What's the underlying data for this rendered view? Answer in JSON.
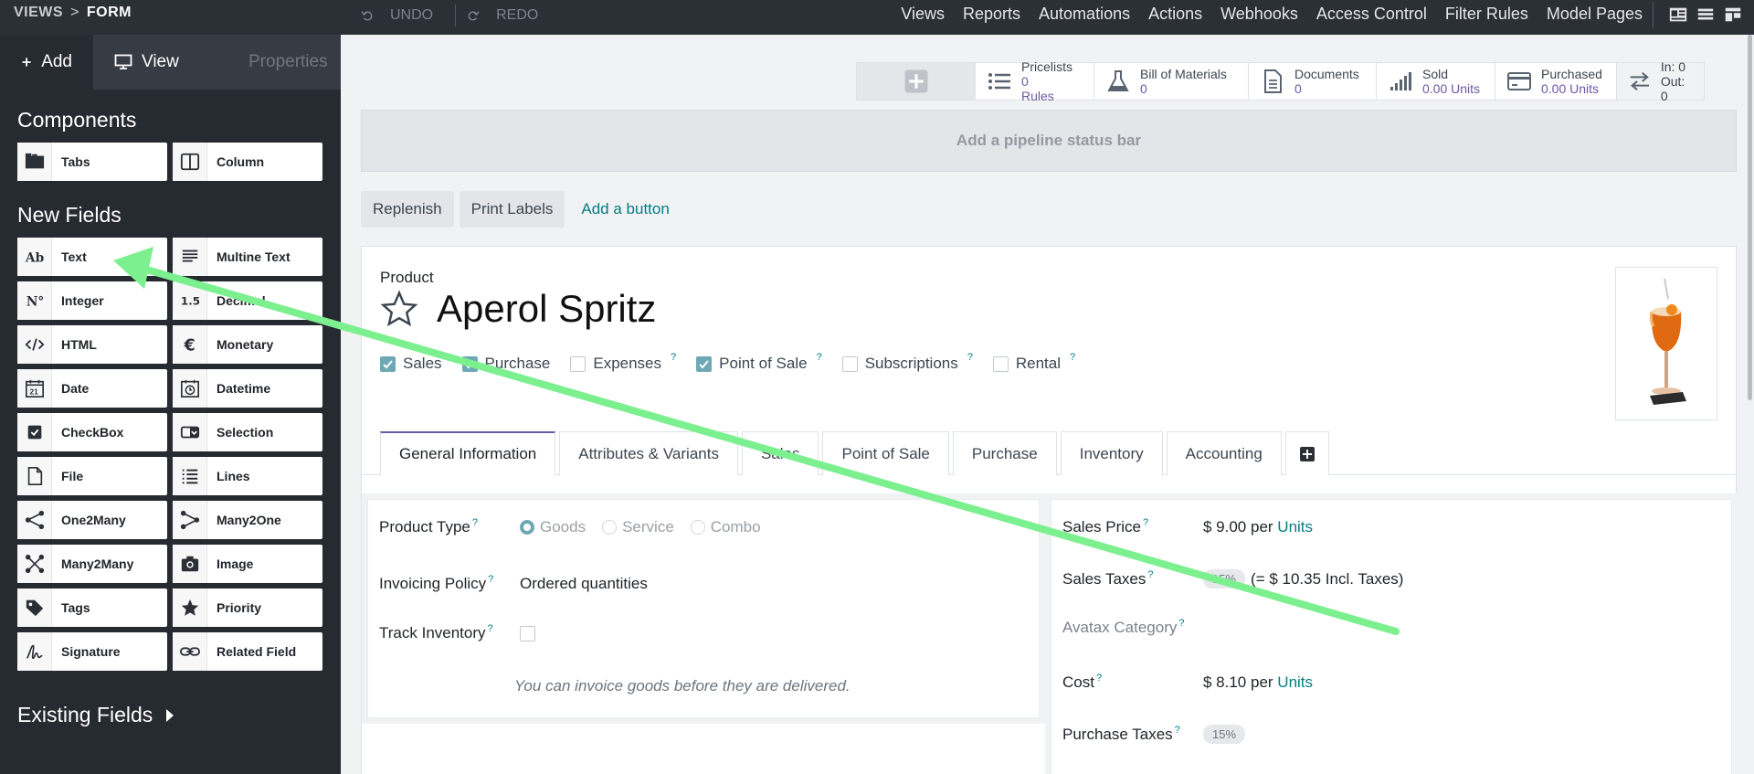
{
  "topbar": {
    "crumb_root": "VIEWS",
    "crumb_sep": ">",
    "crumb_current": "FORM",
    "undo": "UNDO",
    "redo": "REDO",
    "menu": [
      "Views",
      "Reports",
      "Automations",
      "Actions",
      "Webhooks",
      "Access Control",
      "Filter Rules",
      "Model Pages"
    ]
  },
  "sidebar": {
    "tabs": {
      "add": "Add",
      "view": "View",
      "properties": "Properties"
    },
    "components_title": "Components",
    "components": [
      {
        "label": "Tabs",
        "icon": "tabs-icon"
      },
      {
        "label": "Column",
        "icon": "column-icon"
      }
    ],
    "new_fields_title": "New Fields",
    "fields": [
      {
        "label": "Text",
        "icon": "text-icon"
      },
      {
        "label": "Multine Text",
        "icon": "multiline-text-icon"
      },
      {
        "label": "Integer",
        "icon": "integer-icon"
      },
      {
        "label": "Decimal",
        "icon": "decimal-icon"
      },
      {
        "label": "HTML",
        "icon": "html-icon"
      },
      {
        "label": "Monetary",
        "icon": "monetary-icon"
      },
      {
        "label": "Date",
        "icon": "date-icon"
      },
      {
        "label": "Datetime",
        "icon": "datetime-icon"
      },
      {
        "label": "CheckBox",
        "icon": "checkbox-icon"
      },
      {
        "label": "Selection",
        "icon": "selection-icon"
      },
      {
        "label": "File",
        "icon": "file-icon"
      },
      {
        "label": "Lines",
        "icon": "lines-icon"
      },
      {
        "label": "One2Many",
        "icon": "one2many-icon"
      },
      {
        "label": "Many2One",
        "icon": "many2one-icon"
      },
      {
        "label": "Many2Many",
        "icon": "many2many-icon"
      },
      {
        "label": "Image",
        "icon": "image-icon"
      },
      {
        "label": "Tags",
        "icon": "tags-icon"
      },
      {
        "label": "Priority",
        "icon": "priority-icon"
      },
      {
        "label": "Signature",
        "icon": "signature-icon"
      },
      {
        "label": "Related Field",
        "icon": "related-field-icon"
      }
    ],
    "existing_fields": "Existing Fields"
  },
  "smart_buttons": {
    "pricelists": {
      "label": "Pricelists",
      "value": "0",
      "sub": "Rules"
    },
    "bom": {
      "label": "Bill of Materials",
      "value": "0"
    },
    "documents": {
      "label": "Documents",
      "value": "0"
    },
    "sold": {
      "label": "Sold",
      "value": "0.00 Units"
    },
    "purchased": {
      "label": "Purchased",
      "value": "0.00 Units"
    },
    "inout": {
      "in": "In: 0",
      "out": "Out: 0"
    }
  },
  "pipeline": "Add a pipeline status bar",
  "buttons": {
    "replenish": "Replenish",
    "print_labels": "Print Labels",
    "add_button": "Add a button"
  },
  "product": {
    "label": "Product",
    "name": "Aperol Spritz",
    "checks": [
      {
        "label": "Sales",
        "checked": true,
        "help": false
      },
      {
        "label": "Purchase",
        "checked": true,
        "help": false
      },
      {
        "label": "Expenses",
        "checked": false,
        "help": true
      },
      {
        "label": "Point of Sale",
        "checked": true,
        "help": true
      },
      {
        "label": "Subscriptions",
        "checked": false,
        "help": true
      },
      {
        "label": "Rental",
        "checked": false,
        "help": true
      }
    ]
  },
  "tabs": [
    "General Information",
    "Attributes & Variants",
    "Sales",
    "Point of Sale",
    "Purchase",
    "Inventory",
    "Accounting"
  ],
  "help_mark": "?",
  "general": {
    "product_type_label": "Product Type",
    "product_type_options": [
      "Goods",
      "Service",
      "Combo"
    ],
    "invoicing_policy_label": "Invoicing Policy",
    "invoicing_policy_value": "Ordered quantities",
    "track_inventory_label": "Track Inventory",
    "note": "You can invoice goods before they are delivered.",
    "sales_price_label": "Sales Price",
    "sales_price_value": "$ 9.00 per",
    "sales_price_unit": "Units",
    "sales_taxes_label": "Sales Taxes",
    "sales_taxes_tag": "15%",
    "sales_taxes_incl": "(= $ 10.35 Incl. Taxes)",
    "avatax_label": "Avatax Category",
    "cost_label": "Cost",
    "cost_value": "$ 8.10 per",
    "cost_unit": "Units",
    "purchase_taxes_label": "Purchase Taxes",
    "purchase_taxes_tag": "15%"
  },
  "colors": {
    "accent": "#6b58a5",
    "link": "#017e84",
    "arrow": "#7cf08f",
    "sidebar_bg": "#262a31"
  }
}
